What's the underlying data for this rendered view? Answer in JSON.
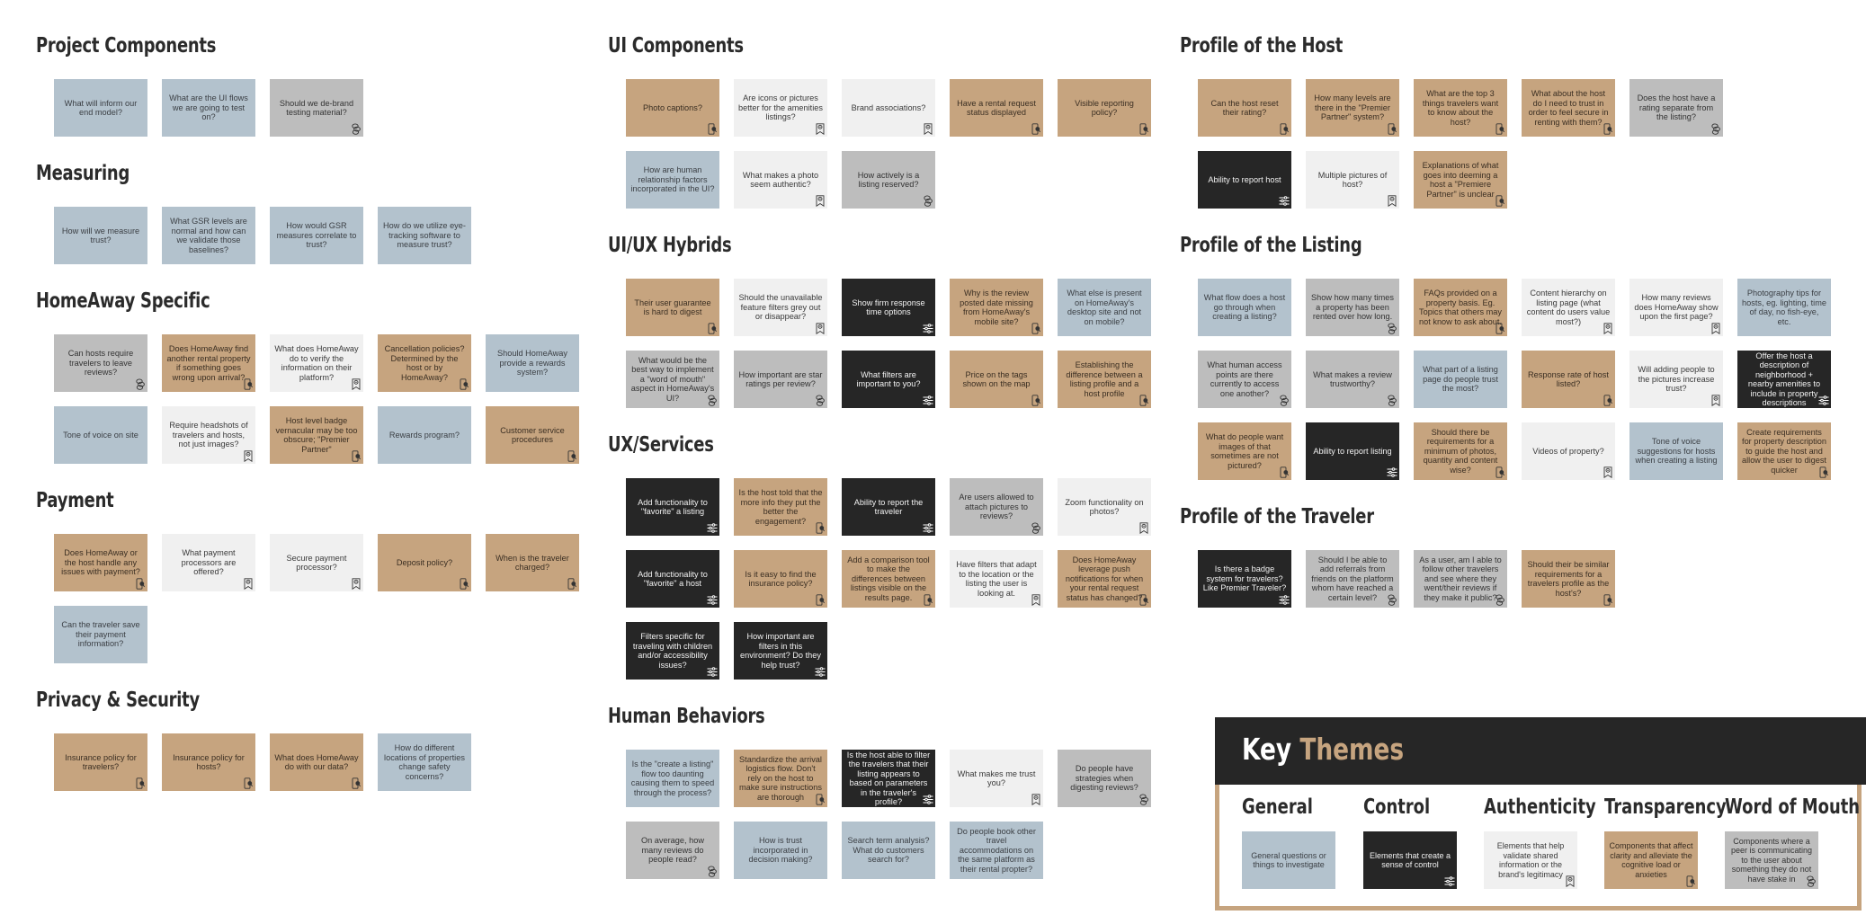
{
  "themes": {
    "general": {
      "label": "General",
      "color": "#b3c2cd",
      "icon": "none"
    },
    "control": {
      "label": "Control",
      "color": "#262626",
      "icon": "sliders-icon"
    },
    "auth": {
      "label": "Authenticity",
      "color": "#f0f0f0",
      "icon": "badge-ribbon-icon"
    },
    "trans": {
      "label": "Transparency",
      "color": "#c6a47f",
      "icon": "phone-search-icon"
    },
    "wom": {
      "label": "Word of Mouth",
      "color": "#bdbdbd",
      "icon": "chat-bubbles-icon"
    }
  },
  "sections": [
    {
      "title": "Project Components",
      "notes": [
        {
          "text": "What will inform our end model?",
          "theme": "general"
        },
        {
          "text": "What are the UI flows we are going to test on?",
          "theme": "general"
        },
        {
          "text": "Should we de-brand testing material?",
          "theme": "wom"
        }
      ]
    },
    {
      "title": "Measuring",
      "notes": [
        {
          "text": "How will we measure trust?",
          "theme": "general"
        },
        {
          "text": "What GSR levels are normal and how can we validate those baselines?",
          "theme": "general"
        },
        {
          "text": "How would GSR measures correlate to trust?",
          "theme": "general"
        },
        {
          "text": "How do we utilize eye-tracking software to measure trust?",
          "theme": "general"
        }
      ]
    },
    {
      "title": "HomeAway Specific",
      "notes": [
        {
          "text": "Can hosts require travelers to leave reviews?",
          "theme": "wom"
        },
        {
          "text": "Does HomeAway find another rental property if something goes wrong upon arrival?",
          "theme": "trans"
        },
        {
          "text": "What does HomeAway do to verify the information on their platform?",
          "theme": "auth"
        },
        {
          "text": "Cancellation policies? Determined by the host or by HomeAway?",
          "theme": "trans"
        },
        {
          "text": "Should HomeAway provide a rewards system?",
          "theme": "general"
        },
        {
          "text": "Tone of voice on site",
          "theme": "general"
        },
        {
          "text": "Require headshots of travelers and hosts, not just images?",
          "theme": "auth"
        },
        {
          "text": "Host level badge vernacular may be too obscure; \"Premier Partner\"",
          "theme": "trans"
        },
        {
          "text": "Rewards program?",
          "theme": "general"
        },
        {
          "text": "Customer service procedures",
          "theme": "trans"
        }
      ]
    },
    {
      "title": "Payment",
      "notes": [
        {
          "text": "Does HomeAway or the host handle any issues with payment?",
          "theme": "trans"
        },
        {
          "text": "What payment processors are offered?",
          "theme": "auth"
        },
        {
          "text": "Secure payment processor?",
          "theme": "auth"
        },
        {
          "text": "Deposit policy?",
          "theme": "trans"
        },
        {
          "text": "When is the traveler charged?",
          "theme": "trans"
        },
        {
          "text": "Can the traveler save their payment information?",
          "theme": "general"
        }
      ]
    },
    {
      "title": "Privacy & Security",
      "notes": [
        {
          "text": "Insurance policy for travelers?",
          "theme": "trans"
        },
        {
          "text": "Insurance policy for hosts?",
          "theme": "trans"
        },
        {
          "text": "What does HomeAway do with our data?",
          "theme": "trans"
        },
        {
          "text": "How do different locations of properties change safety concerns?",
          "theme": "general"
        }
      ]
    },
    {
      "title": "UI Components",
      "notes": [
        {
          "text": "Photo captions?",
          "theme": "trans"
        },
        {
          "text": "Are icons or pictures better for the amenities listings?",
          "theme": "auth"
        },
        {
          "text": "Brand associations?",
          "theme": "auth"
        },
        {
          "text": "Have a rental request status displayed",
          "theme": "trans"
        },
        {
          "text": "Visible reporting policy?",
          "theme": "trans"
        },
        {
          "text": "How are human relationship factors incorporated in the UI?",
          "theme": "general"
        },
        {
          "text": "What makes a photo seem authentic?",
          "theme": "auth"
        },
        {
          "text": "How actively is a listing reserved?",
          "theme": "wom"
        }
      ]
    },
    {
      "title": "UI/UX Hybrids",
      "notes": [
        {
          "text": "Their user guarantee is hard to digest",
          "theme": "trans"
        },
        {
          "text": "Should the unavailable feature filters grey out or disappear?",
          "theme": "auth"
        },
        {
          "text": "Show firm response time options",
          "theme": "control"
        },
        {
          "text": "Why is the review posted date missing from HomeAway's mobile site?",
          "theme": "trans"
        },
        {
          "text": "What else is present on HomeAway's desktop site and not on mobile?",
          "theme": "general"
        },
        {
          "text": "What would be the best way to implement a \"word of mouth\" aspect in HomeAway's UI?",
          "theme": "wom"
        },
        {
          "text": "How important are star ratings per review?",
          "theme": "wom"
        },
        {
          "text": "What filters are important to you?",
          "theme": "control"
        },
        {
          "text": "Price on the tags shown on the map",
          "theme": "trans"
        },
        {
          "text": "Establishing the difference between a listing profile and a host profile",
          "theme": "trans"
        }
      ]
    },
    {
      "title": "UX/Services",
      "notes": [
        {
          "text": "Add functionality to \"favorite\" a listing",
          "theme": "control"
        },
        {
          "text": "Is the host told that the more info they put the better the engagement?",
          "theme": "trans"
        },
        {
          "text": "Ability to report the traveler",
          "theme": "control"
        },
        {
          "text": "Are users allowed to attach pictures to reviews?",
          "theme": "wom"
        },
        {
          "text": "Zoom functionality on photos?",
          "theme": "auth"
        },
        {
          "text": "Add functionality to \"favorite\" a host",
          "theme": "control"
        },
        {
          "text": "Is it easy to find the insurance policy?",
          "theme": "trans"
        },
        {
          "text": "Add a comparison tool to make the differences between listings visible on the results page.",
          "theme": "trans"
        },
        {
          "text": "Have filters that adapt to the location or the listing the user is looking at.",
          "theme": "auth"
        },
        {
          "text": "Does HomeAway leverage push notifications for when your rental request status has changed?",
          "theme": "trans"
        },
        {
          "text": "Filters specific for traveling with children and/or accessibility issues?",
          "theme": "control"
        },
        {
          "text": "How important are filters in this environment? Do they help trust?",
          "theme": "control"
        }
      ]
    },
    {
      "title": "Human Behaviors",
      "notes": [
        {
          "text": "Is the \"create a listing\" flow too daunting causing them to speed through the process?",
          "theme": "general"
        },
        {
          "text": "Standardize the arrival logistics flow. Don't rely on the host to make sure instructions are thorough",
          "theme": "trans"
        },
        {
          "text": "Is the host able to filter the travelers that their listing appears to based on parameters in the traveler's profile?",
          "theme": "control"
        },
        {
          "text": "What makes me trust you?",
          "theme": "auth"
        },
        {
          "text": "Do people have strategies when digesting reviews?",
          "theme": "wom"
        },
        {
          "text": "On average, how many reviews do people read?",
          "theme": "wom"
        },
        {
          "text": "How is trust incorporated in decision making?",
          "theme": "general"
        },
        {
          "text": "Search term analysis? What do customers search for?",
          "theme": "general"
        },
        {
          "text": "Do people book other travel accommodations on the same platform as their rental propter?",
          "theme": "general"
        }
      ]
    },
    {
      "title": "Profile of the Host",
      "notes": [
        {
          "text": "Can the host reset their rating?",
          "theme": "trans"
        },
        {
          "text": "How many levels are there in the \"Premier Partner\" system?",
          "theme": "trans"
        },
        {
          "text": "What are the top 3 things travelers want to know about the host?",
          "theme": "trans"
        },
        {
          "text": "What about the host do I need to trust in order to feel secure in renting with them?",
          "theme": "trans"
        },
        {
          "text": "Does the host have a rating separate from the listing?",
          "theme": "wom"
        },
        {
          "text": "Ability to report host",
          "theme": "control"
        },
        {
          "text": "Multiple pictures of host?",
          "theme": "auth"
        },
        {
          "text": "Explanations of what goes into deeming a host a \"Premiere Partner\" is unclear",
          "theme": "trans"
        }
      ]
    },
    {
      "title": "Profile of the Listing",
      "notes": [
        {
          "text": "What flow does a host go through when creating a listing?",
          "theme": "general"
        },
        {
          "text": "Show how many times a property has been rented over how long.",
          "theme": "wom"
        },
        {
          "text": "FAQs provided on a property basis. Eg. Topics that others may not know to ask about.",
          "theme": "trans"
        },
        {
          "text": "Content hierarchy on listing page (what content do users value most?)",
          "theme": "auth"
        },
        {
          "text": "How many reviews does HomeAway show upon the first page?",
          "theme": "auth"
        },
        {
          "text": "Photography tips for hosts, eg. lighting, time of day, no fish-eye, etc.",
          "theme": "general"
        },
        {
          "text": "What human access points are there currently to access one another?",
          "theme": "wom"
        },
        {
          "text": "What makes a review trustworthy?",
          "theme": "wom"
        },
        {
          "text": "What part of a listing page do people trust the most?",
          "theme": "general"
        },
        {
          "text": "Response rate of host listed?",
          "theme": "trans"
        },
        {
          "text": "Will adding people to the pictures increase trust?",
          "theme": "auth"
        },
        {
          "text": "Offer the host a description of neighborhood + nearby amenities to include in property descriptions",
          "theme": "control"
        },
        {
          "text": "What do people want images of that sometimes are not pictured?",
          "theme": "trans"
        },
        {
          "text": "Ability to report listing",
          "theme": "control"
        },
        {
          "text": "Should there be requirements for a minimum of photos, quantity and content wise?",
          "theme": "trans"
        },
        {
          "text": "Videos of property?",
          "theme": "auth"
        },
        {
          "text": "Tone of voice suggestions for hosts when creating a listing",
          "theme": "general"
        },
        {
          "text": "Create requirements for property description to guide the host and allow the user to digest quicker",
          "theme": "trans"
        }
      ]
    },
    {
      "title": "Profile of the Traveler",
      "notes": [
        {
          "text": "Is there a badge system for travelers? Like Premier Traveler?",
          "theme": "control"
        },
        {
          "text": "Should I be able to add referrals from friends on the platform whom have reached a certain level?",
          "theme": "wom"
        },
        {
          "text": "As a user, am I able to follow other travelers and see where they went/their reviews if they make it public?",
          "theme": "wom"
        },
        {
          "text": "Should their be similar requirements for a travelers profile as the host's?",
          "theme": "trans"
        }
      ]
    }
  ],
  "key": {
    "title_main": "Key",
    "title_accent": "Themes",
    "items": [
      {
        "label": "General",
        "text": "General questions or things to investigate",
        "theme": "general"
      },
      {
        "label": "Control",
        "text": "Elements that create a sense of control",
        "theme": "control"
      },
      {
        "label": "Authenticity",
        "text": "Elements that help validate shared information or the brand's legitimacy",
        "theme": "auth"
      },
      {
        "label": "Transparency",
        "text": "Components that affect clarity and alleviate the cognitive load or anxieties",
        "theme": "trans"
      },
      {
        "label": "Word of Mouth",
        "text": "Components where a peer is communicating to the user about something they do not have stake in",
        "theme": "wom"
      }
    ]
  }
}
